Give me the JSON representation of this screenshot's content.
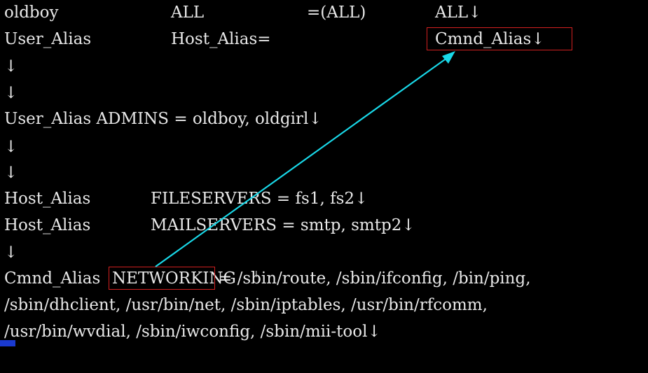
{
  "line1": {
    "col1": "oldboy",
    "col2": "ALL",
    "col3": "=(ALL)",
    "col4": "ALL↓"
  },
  "line2": {
    "col1": "User_Alias",
    "col2": "Host_Alias=",
    "col4": "Cmnd_Alias↓"
  },
  "line3": "↓",
  "line4": "↓",
  "line5": "User_Alias ADMINS = oldboy, oldgirl↓",
  "line6": "↓",
  "line7": "↓",
  "line8": {
    "col1": "Host_Alias",
    "col2": "FILESERVERS = fs1, fs2↓"
  },
  "line9": {
    "col1": "Host_Alias",
    "col2": "MAILSERVERS = smtp, smtp2↓"
  },
  "line10": "↓",
  "line11": {
    "prefix": "Cmnd_Alias",
    "boxed": "NETWORKING",
    "rest": "= /sbin/route, /sbin/ifconfig, /bin/ping,"
  },
  "line12": "/sbin/dhclient, /usr/bin/net, /sbin/iptables, /usr/bin/rfcomm,",
  "line13": "/usr/bin/wvdial, /sbin/iwconfig, /sbin/mii-tool↓",
  "annotation": {
    "arrow_color": "#19d8e8",
    "box_color": "#d42020"
  }
}
